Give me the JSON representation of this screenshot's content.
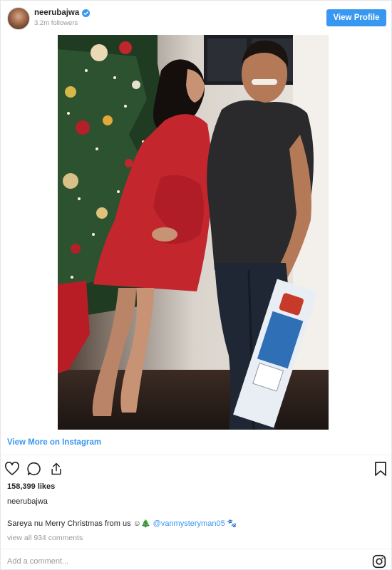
{
  "header": {
    "username": "neerubajwa",
    "followers": "3.2m followers",
    "view_profile_label": "View Profile",
    "verified_color": "#3897f0",
    "avatar_icon": "profile-avatar"
  },
  "post": {
    "image_icon": "photo"
  },
  "footer": {
    "view_more_label": "View More on Instagram",
    "actions": [
      "heart-icon",
      "comment-icon",
      "share-icon"
    ],
    "bookmark_icon": "bookmark-icon",
    "likes": "158,399 likes",
    "author": "neerubajwa",
    "caption_text": "Sareya nu Merry Christmas from us ☺🎄",
    "caption_mention": "@vanmysteryman05",
    "caption_emoji": "🐾",
    "view_comments": "view all 934 comments",
    "add_comment_placeholder": "Add a comment...",
    "instagram_icon": "instagram-icon"
  },
  "colors": {
    "accent": "#3897f0",
    "text": "#262626",
    "muted": "#999999",
    "divider": "#efefef"
  }
}
